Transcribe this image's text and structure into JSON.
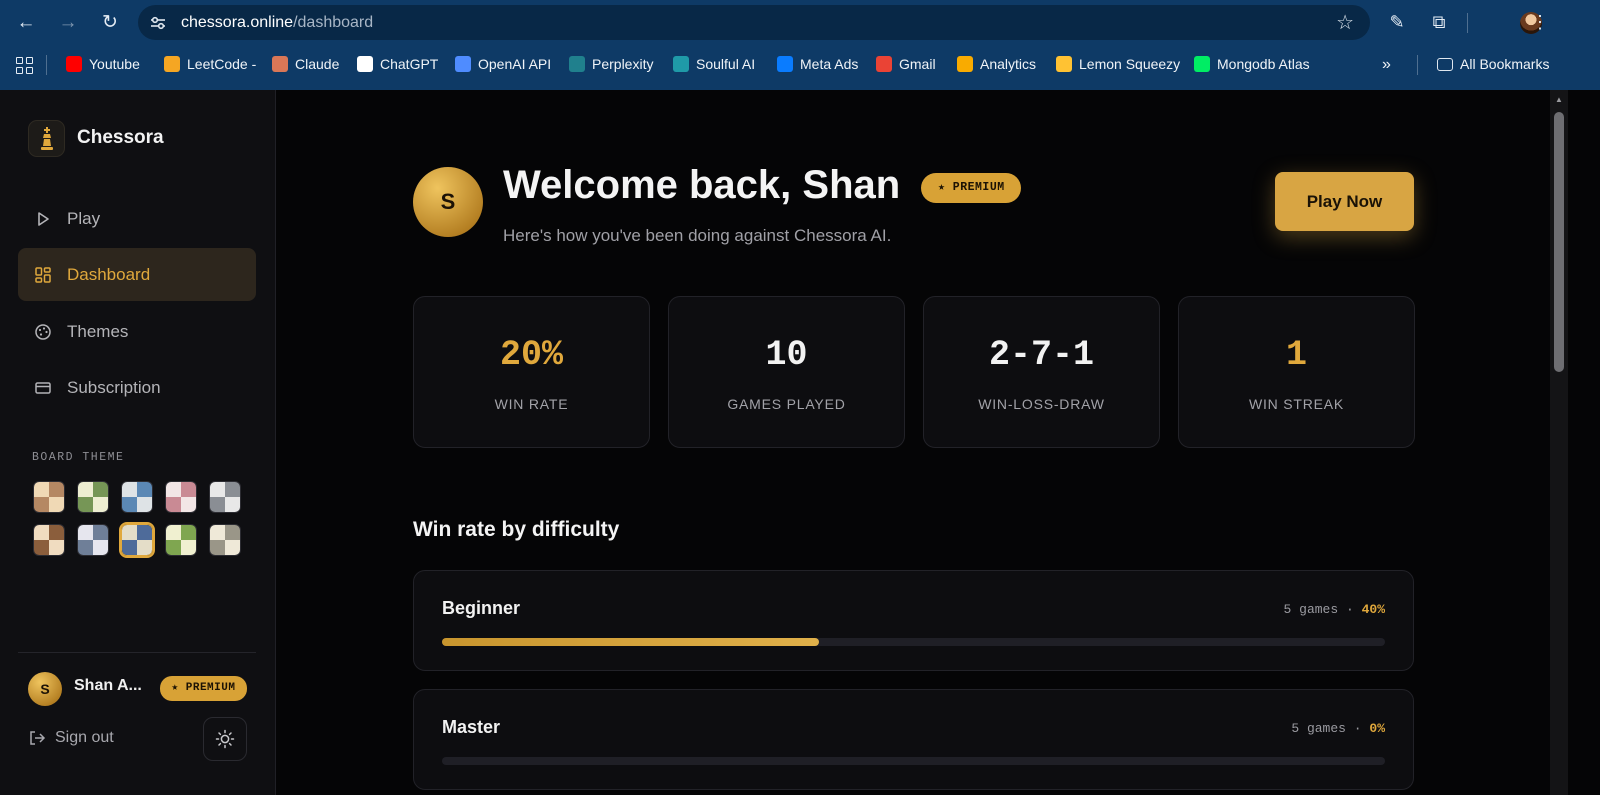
{
  "browser": {
    "url_host": "chessora.online",
    "url_path": "/dashboard",
    "bookmarks": [
      {
        "label": "Youtube",
        "icon": "youtube-icon",
        "color": "#ff0000"
      },
      {
        "label": "LeetCode -",
        "icon": "leetcode-icon",
        "color": "#f5a623"
      },
      {
        "label": "Claude",
        "icon": "claude-icon",
        "color": "#d97757"
      },
      {
        "label": "ChatGPT",
        "icon": "chatgpt-icon",
        "color": "#ffffff"
      },
      {
        "label": "OpenAI API",
        "icon": "openai-icon",
        "color": "#4f8cff"
      },
      {
        "label": "Perplexity",
        "icon": "perplexity-icon",
        "color": "#20808d"
      },
      {
        "label": "Soulful AI",
        "icon": "soulful-icon",
        "color": "#1f9aa8"
      },
      {
        "label": "Meta Ads",
        "icon": "meta-icon",
        "color": "#0a7cff"
      },
      {
        "label": "Gmail",
        "icon": "gmail-icon",
        "color": "#ea4335"
      },
      {
        "label": "Analytics",
        "icon": "analytics-icon",
        "color": "#f9ab00"
      },
      {
        "label": "Lemon Squeezy",
        "icon": "lemon-icon",
        "color": "#ffc233"
      },
      {
        "label": "Mongodb Atlas",
        "icon": "mongodb-icon",
        "color": "#00ed64"
      }
    ],
    "all_bookmarks": "All Bookmarks"
  },
  "sidebar": {
    "brand": "Chessora",
    "nav": [
      {
        "label": "Play",
        "icon": "play-icon",
        "active": false
      },
      {
        "label": "Dashboard",
        "icon": "dashboard-icon",
        "active": true
      },
      {
        "label": "Themes",
        "icon": "palette-icon",
        "active": false
      },
      {
        "label": "Subscription",
        "icon": "card-icon",
        "active": false
      }
    ],
    "board_theme_label": "BOARD THEME",
    "themes": [
      {
        "light": "#f0d9b5",
        "dark": "#b58863"
      },
      {
        "light": "#eeeed2",
        "dark": "#769656"
      },
      {
        "light": "#dee3e6",
        "dark": "#5b88b5"
      },
      {
        "light": "#f2e6e6",
        "dark": "#c98a94"
      },
      {
        "light": "#e8e8e8",
        "dark": "#8a8e94"
      },
      {
        "light": "#f0dcc0",
        "dark": "#8b5e3c"
      },
      {
        "light": "#e6e6ee",
        "dark": "#6f7f98"
      },
      {
        "light": "#e4ddc8",
        "dark": "#4e6b9a",
        "selected": true
      },
      {
        "light": "#f0f0d0",
        "dark": "#7fa650"
      },
      {
        "light": "#efe9d8",
        "dark": "#9a9688"
      }
    ],
    "user": {
      "initial": "S",
      "name": "Shan A...",
      "badge": "★ PREMIUM"
    },
    "sign_out": "Sign out"
  },
  "header": {
    "avatar_initial": "S",
    "welcome": "Welcome back, Shan",
    "badge": "★ PREMIUM",
    "subtitle": "Here's how you've been doing against Chessora AI.",
    "play_now": "Play Now"
  },
  "stats": [
    {
      "value": "20%",
      "label": "WIN RATE",
      "accent": true
    },
    {
      "value": "10",
      "label": "GAMES PLAYED",
      "accent": false
    },
    {
      "value": "2-7-1",
      "label": "WIN-LOSS-DRAW",
      "accent": false
    },
    {
      "value": "1",
      "label": "WIN STREAK",
      "accent": true
    }
  ],
  "difficulty": {
    "title": "Win rate by difficulty",
    "rows": [
      {
        "name": "Beginner",
        "games": "5 games",
        "dot": "·",
        "rate": "40%",
        "progress": 0.4
      },
      {
        "name": "Master",
        "games": "5 games",
        "dot": "·",
        "rate": "0%",
        "progress": 0
      }
    ]
  },
  "colors": {
    "accent": "#e0a83c",
    "button": "#d8a543",
    "background": "#050506"
  }
}
